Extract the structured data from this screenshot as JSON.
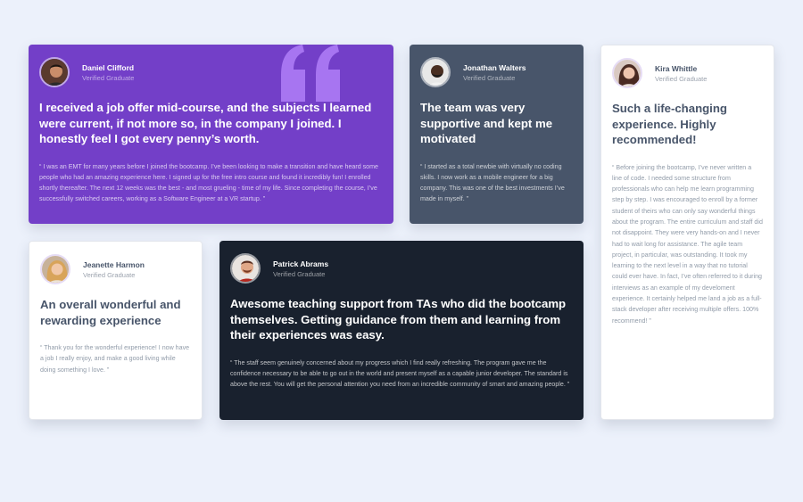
{
  "colors": {
    "background": "#ecf1fb",
    "purple": "#733fc8",
    "slate": "#48556a",
    "dark": "#19212e",
    "white": "#ffffff"
  },
  "testimonials": [
    {
      "name": "Daniel Clifford",
      "role": "Verified Graduate",
      "headline": "I received a job offer mid-course, and the subjects I learned were current, if not more so, in the company I joined. I honestly feel I got every penny’s worth.",
      "quote": "“ I was an EMT for many years before I joined the bootcamp. I’ve been looking to make a transition and have heard some people who had an amazing experience here. I signed up for the free intro course and found it incredibly fun! I enrolled shortly thereafter. The next 12 weeks was the best - and most grueling - time of my life. Since completing the course, I’ve successfully switched careers, working as a Software Engineer at a VR startup. ”"
    },
    {
      "name": "Jonathan Walters",
      "role": "Verified Graduate",
      "headline": "The team was very supportive and kept me motivated",
      "quote": "“ I started as a total newbie with virtually no coding skills. I now work as a mobile engineer for a big company. This was one of the best investments I’ve made in myself. ”"
    },
    {
      "name": "Kira Whittle",
      "role": "Verified Graduate",
      "headline": "Such a life-changing experience. Highly recommended!",
      "quote": "“ Before joining the bootcamp, I’ve never written a line of code. I needed some structure from professionals who can help me learn programming step by step. I was encouraged to enroll by a former student of theirs who can only say wonderful things about the program. The entire curriculum and staff did not disappoint. They were very hands-on and I never had to wait long for assistance. The agile team project, in particular, was outstanding. It took my learning to the next level in a way that no tutorial could ever have. In fact, I’ve often referred to it during interviews as an example of my develoment experience. It certainly helped me land a job as a full-stack developer after receiving multiple offers. 100% recommend! ”"
    },
    {
      "name": "Jeanette Harmon",
      "role": "Verified Graduate",
      "headline": "An overall wonderful and rewarding experience",
      "quote": "“ Thank you for the wonderful experience! I now have a job I really enjoy, and make a good living while doing something I love. ”"
    },
    {
      "name": "Patrick Abrams",
      "role": "Verified Graduate",
      "headline": "Awesome teaching support from TAs who did the bootcamp themselves. Getting guidance from them and learning from their experiences was easy.",
      "quote": "“ The staff seem genuinely concerned about my progress which I find really refreshing. The program gave me the confidence necessary to be able to go out in the world and present myself as a capable junior developer. The standard is above the rest. You will get the personal attention you need from an incredible community of smart and amazing people. ”"
    }
  ],
  "icons": {
    "quote_decoration": "quotation-mark-icon"
  }
}
